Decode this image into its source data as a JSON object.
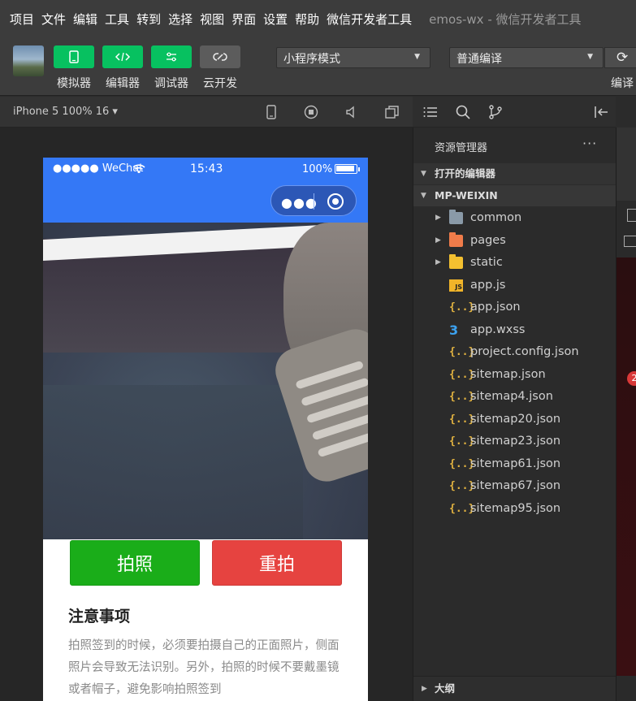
{
  "menu": {
    "items": [
      "项目",
      "文件",
      "编辑",
      "工具",
      "转到",
      "选择",
      "视图",
      "界面",
      "设置",
      "帮助",
      "微信开发者工具"
    ],
    "window_title": "emos-wx - 微信开发者工具"
  },
  "toolbar": {
    "simulator_label": "模拟器",
    "editor_label": "编辑器",
    "debugger_label": "调试器",
    "cloud_label": "云开发",
    "mode_select": "小程序模式",
    "compile_select": "普通编译",
    "compile_label": "编译"
  },
  "simulator": {
    "device": "iPhone 5 100% 16 ▾",
    "status_carrier": "●●●●● WeChat",
    "status_time": "15:43",
    "status_battery": "100%",
    "capsule_dots": "●●●",
    "shoot_button": "拍照",
    "retake_button": "重拍",
    "notes_title": "注意事项",
    "notes_body": "拍照签到的时候，必须要拍摄自己的正面照片，侧面照片会导致无法识别。另外，拍照的时候不要戴墨镜或者帽子，避免影响拍照签到"
  },
  "explorer": {
    "title": "资源管理器",
    "more": "···",
    "open_editors": "打开的编辑器",
    "root": "MP-WEIXIN",
    "outline": "大纲",
    "folders": [
      {
        "name": "common",
        "color": "#8a9aa8"
      },
      {
        "name": "pages",
        "color": "#f07c4a"
      },
      {
        "name": "static",
        "color": "#f4c030"
      }
    ],
    "files": [
      {
        "name": "app.js",
        "icon": "js-icon",
        "glyph": "JS"
      },
      {
        "name": "app.json",
        "icon": "json-icon",
        "glyph": "{..}"
      },
      {
        "name": "app.wxss",
        "icon": "css-icon",
        "glyph": "3"
      },
      {
        "name": "project.config.json",
        "icon": "json-icon",
        "glyph": "{..}"
      },
      {
        "name": "sitemap.json",
        "icon": "json-icon",
        "glyph": "{..}"
      },
      {
        "name": "sitemap4.json",
        "icon": "json-icon",
        "glyph": "{..}"
      },
      {
        "name": "sitemap20.json",
        "icon": "json-icon",
        "glyph": "{..}"
      },
      {
        "name": "sitemap23.json",
        "icon": "json-icon",
        "glyph": "{..}"
      },
      {
        "name": "sitemap61.json",
        "icon": "json-icon",
        "glyph": "{..}"
      },
      {
        "name": "sitemap67.json",
        "icon": "json-icon",
        "glyph": "{..}"
      },
      {
        "name": "sitemap95.json",
        "icon": "json-icon",
        "glyph": "{..}"
      }
    ]
  },
  "right_panel": {
    "badge": "2"
  },
  "colors": {
    "accent_green": "#07c160",
    "navbar_blue": "#3478f6",
    "shoot_green": "#1aad19",
    "retake_red": "#e64340"
  }
}
